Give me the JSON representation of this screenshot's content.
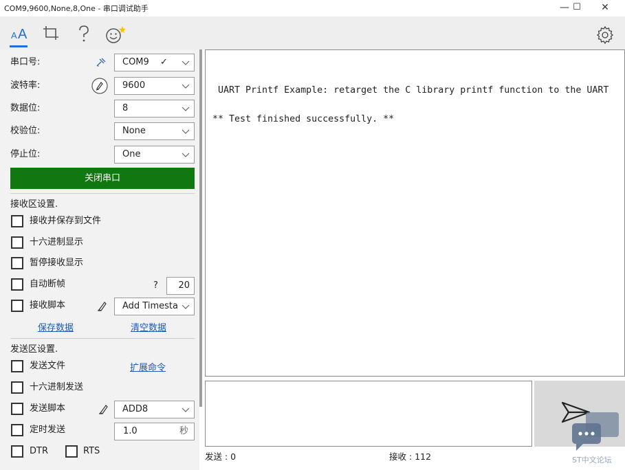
{
  "window": {
    "title": "COM9,9600,None,8,One - 串口调试助手",
    "minimize": "—",
    "maximize": "☐",
    "close": "✕"
  },
  "toolbar": {
    "font_label": "A",
    "font_label_small": "A",
    "crop_glyph": "⌗",
    "help_glyph": "?",
    "settings_glyph": "⚙"
  },
  "serial": {
    "port_label": "串口号:",
    "port_value": "COM9",
    "port_check": "✓",
    "baud_label": "波特率:",
    "baud_value": "9600",
    "databits_label": "数据位:",
    "databits_value": "8",
    "parity_label": "校验位:",
    "parity_value": "None",
    "stopbits_label": "停止位:",
    "stopbits_value": "One",
    "open_button": "关闭串口"
  },
  "receive_settings": {
    "header": "接收区设置.",
    "save_to_file": "接收并保存到文件",
    "hex_display": "十六进制显示",
    "pause_display": "暂停接收显示",
    "auto_frame": "自动断帧",
    "auto_frame_help": "?",
    "auto_frame_value": "20",
    "script": "接收脚本",
    "script_value": "Add Timesta",
    "save_data": "保存数据",
    "clear_data": "清空数据"
  },
  "send_settings": {
    "header": "发送区设置.",
    "send_file": "发送文件",
    "ext_cmd": "扩展命令",
    "hex_send": "十六进制发送",
    "script": "发送脚本",
    "script_value": "ADD8",
    "timed_send": "定时发送",
    "timed_value": "1.0",
    "timed_unit": "秒",
    "dtr": "DTR",
    "rts": "RTS"
  },
  "receive_text": " UART Printf Example: retarget the C library printf function to the UART\n\n** Test finished successfully. **",
  "status": {
    "sent": "发送 : 0",
    "received": "接收 : 112"
  },
  "watermark": "ST中文论坛",
  "colors": {
    "accent": "#1e6fd9",
    "open_button": "#117711",
    "panel": "#f2f2f2",
    "toolbar": "#eeeeee"
  }
}
